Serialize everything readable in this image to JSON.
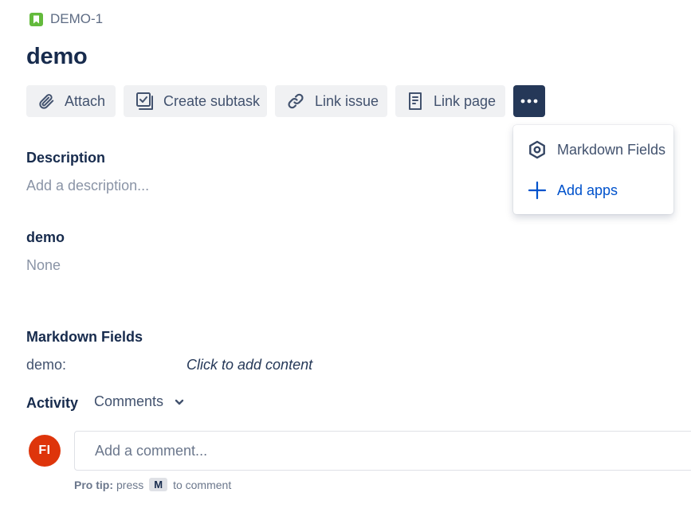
{
  "issue": {
    "key": "DEMO-1",
    "type_icon": "story-icon",
    "title": "demo"
  },
  "toolbar": {
    "attach_label": "Attach",
    "create_subtask_label": "Create subtask",
    "link_issue_label": "Link issue",
    "link_page_label": "Link page",
    "more_icon": "more-icon"
  },
  "dropdown": {
    "items": [
      {
        "label": "Markdown Fields",
        "icon": "hexagon-icon"
      },
      {
        "label": "Add apps",
        "icon": "plus-icon"
      }
    ]
  },
  "fields": {
    "description_label": "Description",
    "description_placeholder": "Add a description...",
    "demo_label": "demo",
    "demo_value": "None",
    "markdown_label": "Markdown Fields",
    "markdown_key": "demo:",
    "markdown_value": "Click to add content"
  },
  "activity": {
    "label": "Activity",
    "filter_value": "Comments"
  },
  "comment": {
    "avatar_initials": "FI",
    "placeholder": "Add a comment...",
    "protip_prefix": "Pro tip:",
    "protip_press": "press",
    "protip_key": "M",
    "protip_suffix": "to comment"
  },
  "colors": {
    "primary_dark": "#253858",
    "link_blue": "#0052cc",
    "story_green": "#63ba3c",
    "avatar_red": "#de350b"
  }
}
